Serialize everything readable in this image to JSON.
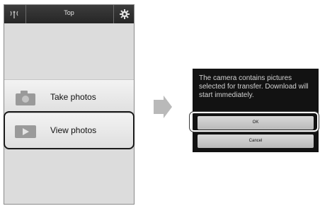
{
  "phone": {
    "title": "Top",
    "menu": [
      {
        "label": "Take photos",
        "icon": "camera-icon"
      },
      {
        "label": "View photos",
        "icon": "playback-icon"
      }
    ]
  },
  "dialog": {
    "message": "The camera contains pictures selected for transfer. Download will start immediately.",
    "ok_label": "OK",
    "cancel_label": "Cancel"
  },
  "colors": {
    "topbar": "#2e2e2e",
    "dialog_bg": "#121212",
    "button": "#c8c8c8",
    "highlight_ring": "#1a1a1a"
  }
}
